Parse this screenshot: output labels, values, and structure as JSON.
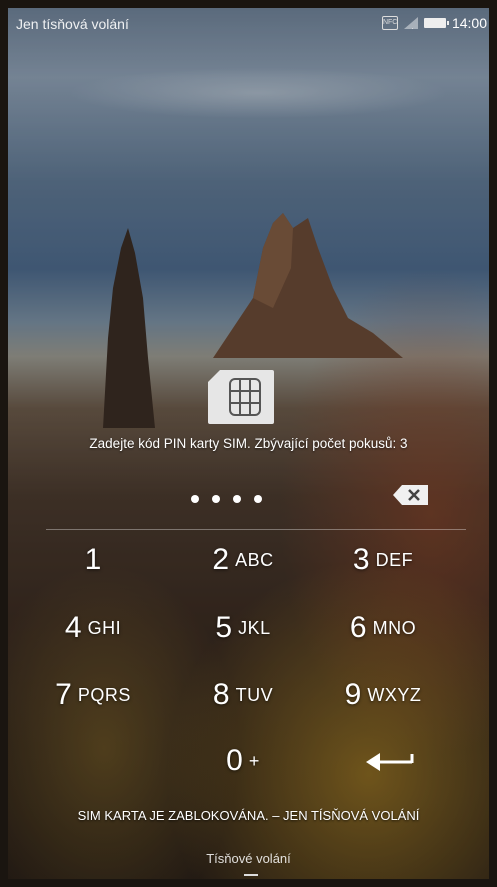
{
  "status_bar": {
    "carrier_text": "Jen tísňová volání",
    "time": "14:00",
    "nfc_label": "NFC"
  },
  "sim_prompt": "Zadejte kód PIN karty SIM. Zbývající počet pokusů: 3",
  "pin_entry": {
    "entered_digits_count": 4
  },
  "keypad": {
    "k1": {
      "num": "1",
      "letters": ""
    },
    "k2": {
      "num": "2",
      "letters": "ABC"
    },
    "k3": {
      "num": "3",
      "letters": "DEF"
    },
    "k4": {
      "num": "4",
      "letters": "GHI"
    },
    "k5": {
      "num": "5",
      "letters": "JKL"
    },
    "k6": {
      "num": "6",
      "letters": "MNO"
    },
    "k7": {
      "num": "7",
      "letters": "PQRS"
    },
    "k8": {
      "num": "8",
      "letters": "TUV"
    },
    "k9": {
      "num": "9",
      "letters": "WXYZ"
    },
    "k0": {
      "num": "0",
      "letters": "+"
    }
  },
  "blocked_message": "SIM KARTA JE ZABLOKOVÁNA. – JEN TÍSŇOVÁ VOLÁNÍ",
  "emergency_call_label": "Tísňové volání",
  "icons": {
    "sim": "sim-card-icon",
    "backspace": "backspace-icon",
    "enter": "enter-icon"
  }
}
